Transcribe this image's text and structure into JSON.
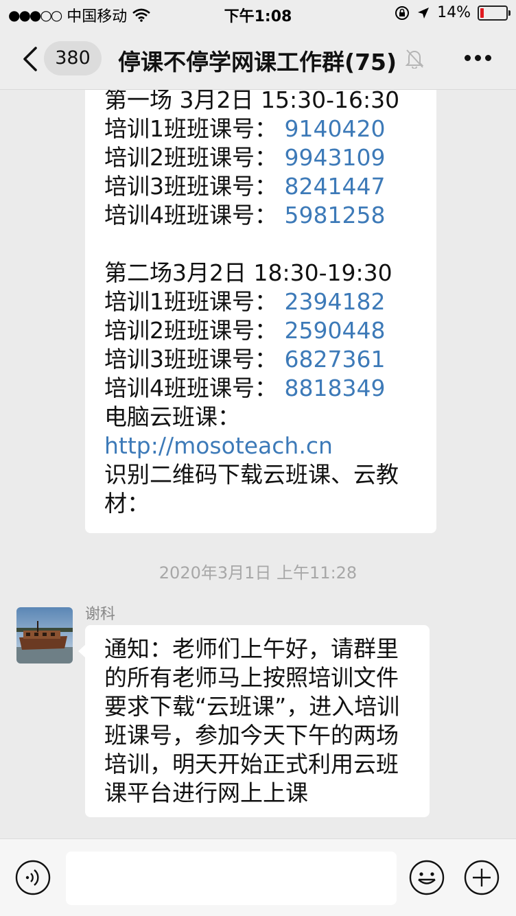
{
  "status_bar": {
    "signal": "●●●○○",
    "carrier": "中国移动",
    "time": "下午1:08",
    "battery_percent": "14%",
    "battery_level": 0.14,
    "battery_color": "#e0191f"
  },
  "header": {
    "unread_count": "380",
    "title": "停课不停学网课工作群(75)",
    "icons": [
      "back-chevron-icon",
      "mute-bell-icon",
      "more-dots-icon"
    ]
  },
  "messages": [
    {
      "type": "incoming_text",
      "lines": [
        {
          "label": "第一场 3月2日 15:30-16:30",
          "value": ""
        },
        {
          "label": "培训1班班课号：",
          "value": "9140420"
        },
        {
          "label": "培训2班班课号：",
          "value": "9943109"
        },
        {
          "label": "培训3班班课号：",
          "value": "8241447"
        },
        {
          "label": "培训4班班课号：",
          "value": "5981258"
        },
        {
          "label": "",
          "value": ""
        },
        {
          "label": "第二场3月2日 18:30-19:30",
          "value": ""
        },
        {
          "label": "培训1班班课号：",
          "value": "2394182"
        },
        {
          "label": "培训2班班课号：",
          "value": "2590448"
        },
        {
          "label": "培训3班班课号：",
          "value": "6827361"
        },
        {
          "label": "培训4班班课号：",
          "value": "8818349"
        },
        {
          "label": "电脑云班课：",
          "value": ""
        }
      ],
      "link": "http://mosoteach.cn",
      "tail_lines": [
        "识别二维码下载云班课、云教",
        "材："
      ]
    },
    {
      "type": "incoming_text",
      "timestamp": "2020年3月1日 上午11:28",
      "sender": "谢科",
      "lines": [
        "通知：老师们上午好，请群里",
        "的所有老师马上按照培训文件",
        "要求下载“云班课”，进入培训",
        "班课号，参加今天下午的两场",
        "培训，明天开始正式利用云班",
        "课平台进行网上上课"
      ]
    }
  ],
  "input_bar": {
    "placeholder": "",
    "icons": [
      "voice-icon",
      "emoji-icon",
      "plus-icon"
    ]
  },
  "colors": {
    "background": "#ebebeb",
    "bubble": "#ffffff",
    "link": "#3d7ab8",
    "timestamp": "#a7a7a7"
  }
}
